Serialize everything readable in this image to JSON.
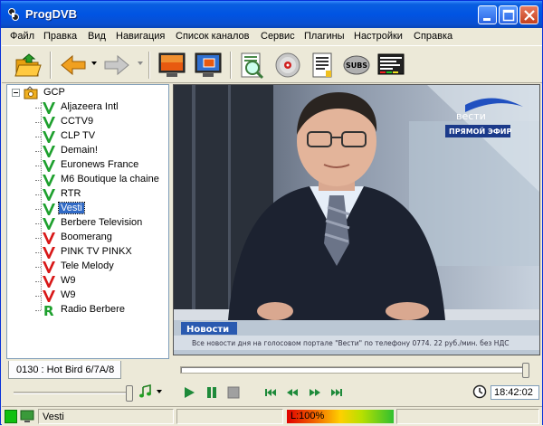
{
  "window": {
    "title": "ProgDVB"
  },
  "menu": [
    {
      "label": "Файл"
    },
    {
      "label": "Правка"
    },
    {
      "label": "Вид"
    },
    {
      "label": "Навигация"
    },
    {
      "label": "Список каналов"
    },
    {
      "label": "Сервис"
    },
    {
      "label": "Плагины"
    },
    {
      "label": "Настройки"
    },
    {
      "label": "Справка"
    }
  ],
  "toolbar": {
    "subs_label": "SUBS"
  },
  "tree": {
    "root_label": "GCP",
    "channels": [
      {
        "name": "Aljazeera Intl",
        "icon": "v-checkmark-icon",
        "selected": false
      },
      {
        "name": "CCTV9",
        "icon": "v-checkmark-icon",
        "selected": false
      },
      {
        "name": "CLP TV",
        "icon": "v-checkmark-icon",
        "selected": false
      },
      {
        "name": "Demain!",
        "icon": "v-checkmark-icon",
        "selected": false
      },
      {
        "name": "Euronews France",
        "icon": "v-checkmark-icon",
        "selected": false
      },
      {
        "name": "M6 Boutique la chaine",
        "icon": "v-checkmark-icon",
        "selected": false
      },
      {
        "name": "RTR",
        "icon": "v-checkmark-icon",
        "selected": false
      },
      {
        "name": "Vesti",
        "icon": "v-checkmark-icon",
        "selected": true
      },
      {
        "name": "Berbere Television",
        "icon": "v-checkmark-icon",
        "selected": false
      },
      {
        "name": "Boomerang",
        "icon": "v-red-icon",
        "selected": false
      },
      {
        "name": "PINK TV PINKX",
        "icon": "v-red-icon",
        "selected": false
      },
      {
        "name": "Tele Melody",
        "icon": "v-red-icon",
        "selected": false
      },
      {
        "name": "W9",
        "icon": "v-red-icon",
        "selected": false
      },
      {
        "name": "W9",
        "icon": "v-red-icon",
        "selected": false
      },
      {
        "name": "Radio Berbere",
        "icon": "r-radio-icon",
        "selected": false
      }
    ]
  },
  "transponder_tab": {
    "label": "0130 : Hot Bird 6/7A/8"
  },
  "video": {
    "channel_logo": "вести",
    "live_badge": "ПРЯМОЙ ЭФИР",
    "ticker_title": "Новости",
    "ticker_text": "Все новости дня на голосовом портале \"Вести\" по телефону 0774. 22 руб./мин. без НДС"
  },
  "player": {
    "time": "18:42:02",
    "volume_fraction": 1.0,
    "seek_fraction": 1.0
  },
  "status": {
    "channel": "Vesti",
    "signal_label": "L:100%",
    "signal_level": 1.0
  }
}
